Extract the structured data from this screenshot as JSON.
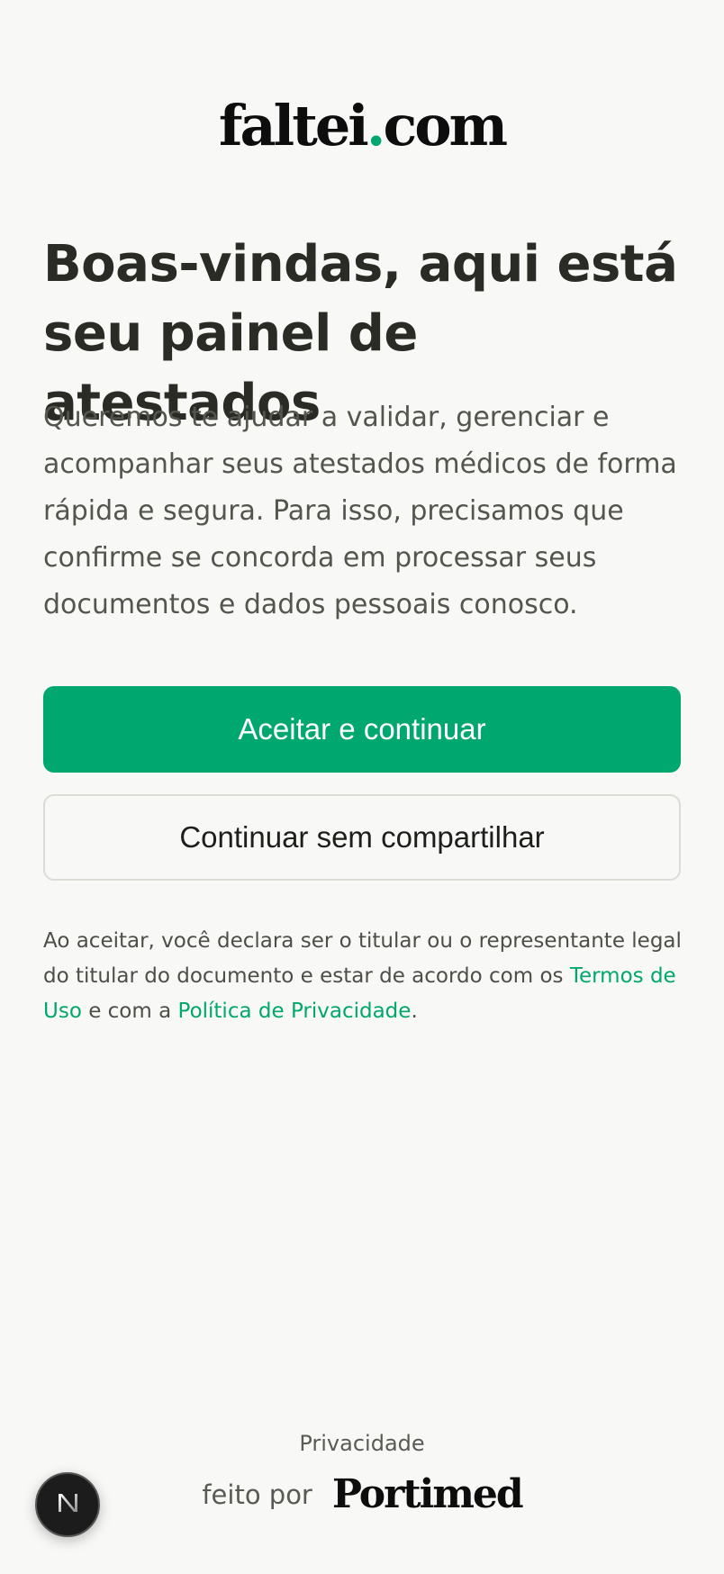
{
  "logo": {
    "name": "faltei",
    "dot": ".",
    "tld": "com"
  },
  "title": "Boas-vindas, aqui está seu painel de atestados",
  "intro": "Queremos te ajudar a validar, gerenciar e acompanhar seus atestados médicos de forma rápida e segura. Para isso, precisamos que confirme se concorda em processar seus documentos e dados pessoais conosco.",
  "buttons": {
    "accept": "Aceitar e continuar",
    "decline": "Continuar sem compartilhar"
  },
  "legal": {
    "prefix": "Ao aceitar, você declara ser o titular ou o representante legal do titular do documento e estar de acordo com os ",
    "terms_link": "Termos de Uso",
    "middle": " e com a ",
    "privacy_link": "Política de Privacidade",
    "suffix": "."
  },
  "footer": {
    "privacy": "Privacidade",
    "made_by": "feito por",
    "brand": "Portimed"
  },
  "colors": {
    "accent": "#00a76f",
    "background": "#f8f8f6",
    "text": "#2a2a24"
  },
  "icons": {
    "fab": "next-n-icon"
  }
}
